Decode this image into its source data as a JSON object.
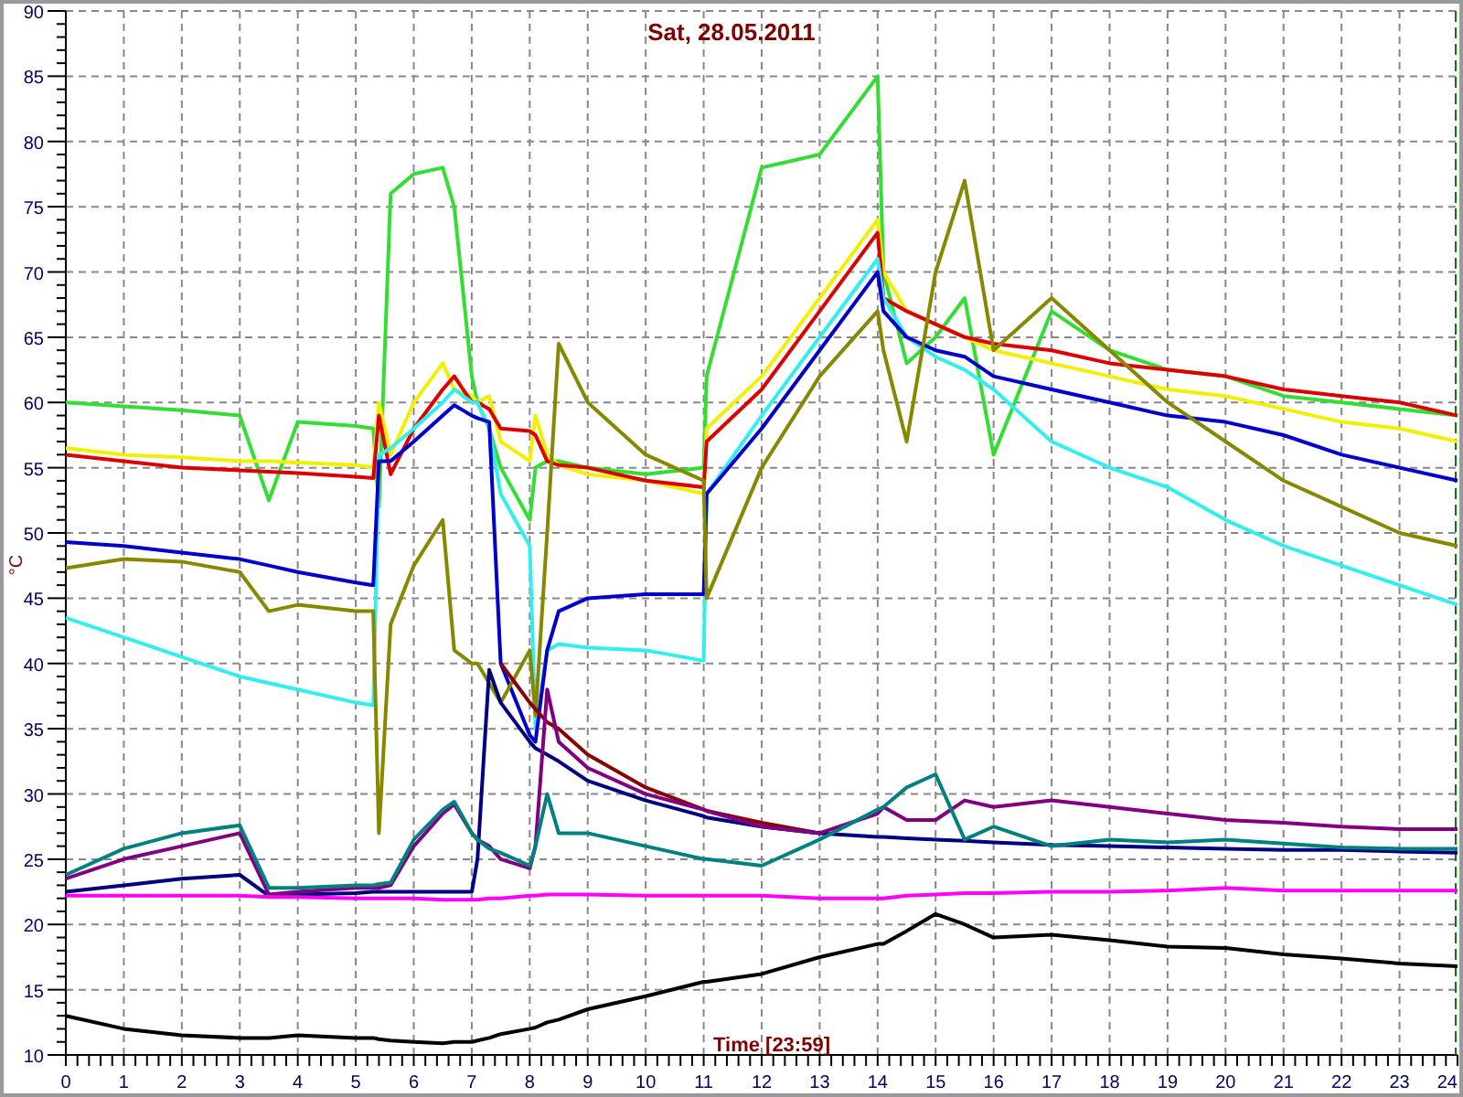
{
  "chart": {
    "chart_data": {
      "type": "line",
      "title": "Sat, 28.05.2011",
      "xlabel": "Time [23:59]",
      "ylabel": "°C",
      "x": [
        0,
        1,
        2,
        3,
        3.5,
        4,
        5,
        5.3,
        5.4,
        5.6,
        6,
        6.5,
        6.7,
        7,
        7.1,
        7.3,
        7.5,
        8,
        8.1,
        8.3,
        8.5,
        9,
        10,
        11,
        11.05,
        12,
        13,
        14,
        14.1,
        14.5,
        15,
        15.5,
        16,
        17,
        18,
        19,
        20,
        21,
        22,
        23,
        24
      ],
      "series": [
        {
          "color": "#33dd33",
          "values": [
            60,
            59.7,
            59.4,
            59,
            52.5,
            58.5,
            58.2,
            58,
            52,
            76,
            77.5,
            78,
            75,
            62,
            60,
            58,
            55,
            51,
            55,
            55.5,
            55.5,
            55,
            54.5,
            55,
            62,
            78,
            79,
            85,
            70,
            63,
            65,
            68,
            56,
            67,
            64,
            62.5,
            62,
            60.5,
            60,
            59.5,
            59
          ]
        },
        {
          "color": "#f0f000",
          "values": [
            56.5,
            56,
            55.8,
            55.5,
            55.5,
            55.4,
            55.2,
            55,
            60,
            56,
            60,
            63,
            61,
            60.5,
            60,
            60.5,
            57,
            55.5,
            59,
            56,
            55.2,
            54.5,
            54,
            53,
            58,
            62,
            68,
            74,
            70,
            67,
            66,
            65,
            64,
            63,
            62,
            61,
            60.5,
            59.5,
            58.5,
            58,
            57
          ]
        },
        {
          "color": "#dd0000",
          "values": [
            56,
            55.5,
            55,
            54.8,
            54.7,
            54.6,
            54.3,
            54.2,
            59,
            54.5,
            58,
            61,
            62,
            60,
            60,
            59.5,
            58,
            57.8,
            57.5,
            55.5,
            55.2,
            55,
            54,
            53.5,
            57,
            61,
            67,
            73,
            68,
            67,
            66,
            65,
            64.5,
            64,
            63,
            62.5,
            62,
            61,
            60.5,
            60,
            59
          ]
        },
        {
          "color": "#33eeee",
          "values": [
            43.5,
            42,
            40.5,
            39,
            38.5,
            38,
            37,
            36.8,
            56,
            56.5,
            58,
            60,
            61,
            60,
            60,
            58,
            53,
            49,
            35,
            41,
            41.5,
            41.2,
            41,
            40.2,
            53,
            59,
            65,
            71,
            68,
            65,
            63.5,
            62.5,
            61,
            57,
            55,
            53.5,
            51,
            49,
            47.5,
            46,
            44.5
          ]
        },
        {
          "color": "#0000cc",
          "values": [
            49.3,
            49,
            48.5,
            48,
            47.5,
            47,
            46.2,
            46,
            55.5,
            55.5,
            57,
            59,
            59.8,
            59,
            58.8,
            58.5,
            40,
            34.5,
            34,
            41,
            44,
            45,
            45.3,
            45.3,
            53,
            58,
            64,
            70,
            67,
            65,
            64,
            63.5,
            62,
            61,
            60,
            59,
            58.5,
            57.5,
            56,
            55,
            54
          ]
        },
        {
          "color": "#888800",
          "values": [
            47.3,
            48,
            47.8,
            47,
            44,
            44.5,
            44,
            44,
            27,
            43,
            47.5,
            51,
            41,
            40,
            40,
            38.5,
            37,
            41,
            36,
            50,
            64.5,
            60,
            56,
            54,
            45,
            55,
            62,
            67,
            64,
            57,
            70,
            77,
            64,
            68,
            64,
            60,
            57,
            54,
            52,
            50,
            49
          ]
        },
        {
          "color": "#880000",
          "values": [
            null,
            null,
            null,
            null,
            null,
            null,
            null,
            null,
            null,
            null,
            null,
            null,
            null,
            null,
            null,
            null,
            40,
            37,
            36.5,
            35.5,
            35,
            33,
            30.5,
            28.8,
            28.7,
            27.8,
            27,
            null,
            null,
            null,
            null,
            null,
            null,
            null,
            null,
            null,
            null,
            null,
            null,
            null,
            null
          ]
        },
        {
          "color": "#000080",
          "values": [
            22.5,
            23,
            23.5,
            23.8,
            22.2,
            22.3,
            22.4,
            22.5,
            22.5,
            22.5,
            22.5,
            22.5,
            22.5,
            22.5,
            25,
            39.5,
            37,
            34,
            33.5,
            33,
            32.5,
            31,
            29.5,
            28.3,
            28.2,
            27.5,
            27,
            26.7,
            26.7,
            26.6,
            26.5,
            26.4,
            26.3,
            26.1,
            26,
            25.9,
            25.8,
            25.7,
            25.7,
            25.6,
            25.5
          ]
        },
        {
          "color": "#800080",
          "values": [
            23.5,
            25,
            26,
            27,
            22.3,
            22.5,
            22.8,
            22.8,
            22.8,
            23,
            26,
            28.5,
            29.2,
            27,
            26.5,
            26,
            25,
            24.3,
            26,
            38,
            34,
            32,
            30,
            28.8,
            28.7,
            27.5,
            27,
            28.5,
            29,
            28,
            28,
            29.5,
            29,
            29.5,
            29,
            28.5,
            28,
            27.8,
            27.5,
            27.3,
            27.3
          ]
        },
        {
          "color": "#008080",
          "values": [
            23.8,
            25.8,
            27,
            27.6,
            22.8,
            22.8,
            23,
            23,
            23.1,
            23.2,
            26.5,
            28.8,
            29.4,
            27,
            26.5,
            25.8,
            25.5,
            24.5,
            26,
            30,
            27,
            27,
            26,
            25,
            25,
            24.5,
            26.5,
            28.8,
            29,
            30.5,
            31.5,
            26.5,
            27.5,
            26,
            26.5,
            26.3,
            26.5,
            26.2,
            25.9,
            25.8,
            25.8
          ]
        },
        {
          "color": "#ff00ff",
          "values": [
            22.2,
            22.2,
            22.2,
            22.2,
            22.1,
            22.1,
            22,
            22,
            22,
            22,
            22,
            21.9,
            21.9,
            21.9,
            21.9,
            22,
            22,
            22.2,
            22.2,
            22.3,
            22.3,
            22.3,
            22.2,
            22.2,
            22.2,
            22.2,
            22,
            22,
            22,
            22.2,
            22.3,
            22.4,
            22.4,
            22.5,
            22.5,
            22.6,
            22.8,
            22.6,
            22.6,
            22.6,
            22.6
          ]
        },
        {
          "color": "#000000",
          "values": [
            13,
            12,
            11.5,
            11.3,
            11.3,
            11.5,
            11.3,
            11.3,
            11.2,
            11.1,
            11,
            10.9,
            11,
            11,
            11.1,
            11.3,
            11.6,
            12,
            12.1,
            12.5,
            12.7,
            13.5,
            14.5,
            15.6,
            15.6,
            16.2,
            17.5,
            18.5,
            18.5,
            19.5,
            20.8,
            20,
            19,
            19.2,
            18.8,
            18.3,
            18.2,
            17.7,
            17.4,
            17,
            16.8
          ]
        }
      ],
      "xlim": [
        0,
        24
      ],
      "ylim": [
        10,
        90
      ],
      "xticks": [
        0,
        1,
        2,
        3,
        4,
        5,
        6,
        7,
        8,
        9,
        10,
        11,
        12,
        13,
        14,
        15,
        16,
        17,
        18,
        19,
        20,
        21,
        22,
        23,
        24
      ],
      "yticks": [
        10,
        15,
        20,
        25,
        30,
        35,
        40,
        45,
        50,
        55,
        60,
        65,
        70,
        75,
        80,
        85,
        90
      ],
      "grid": true
    }
  }
}
